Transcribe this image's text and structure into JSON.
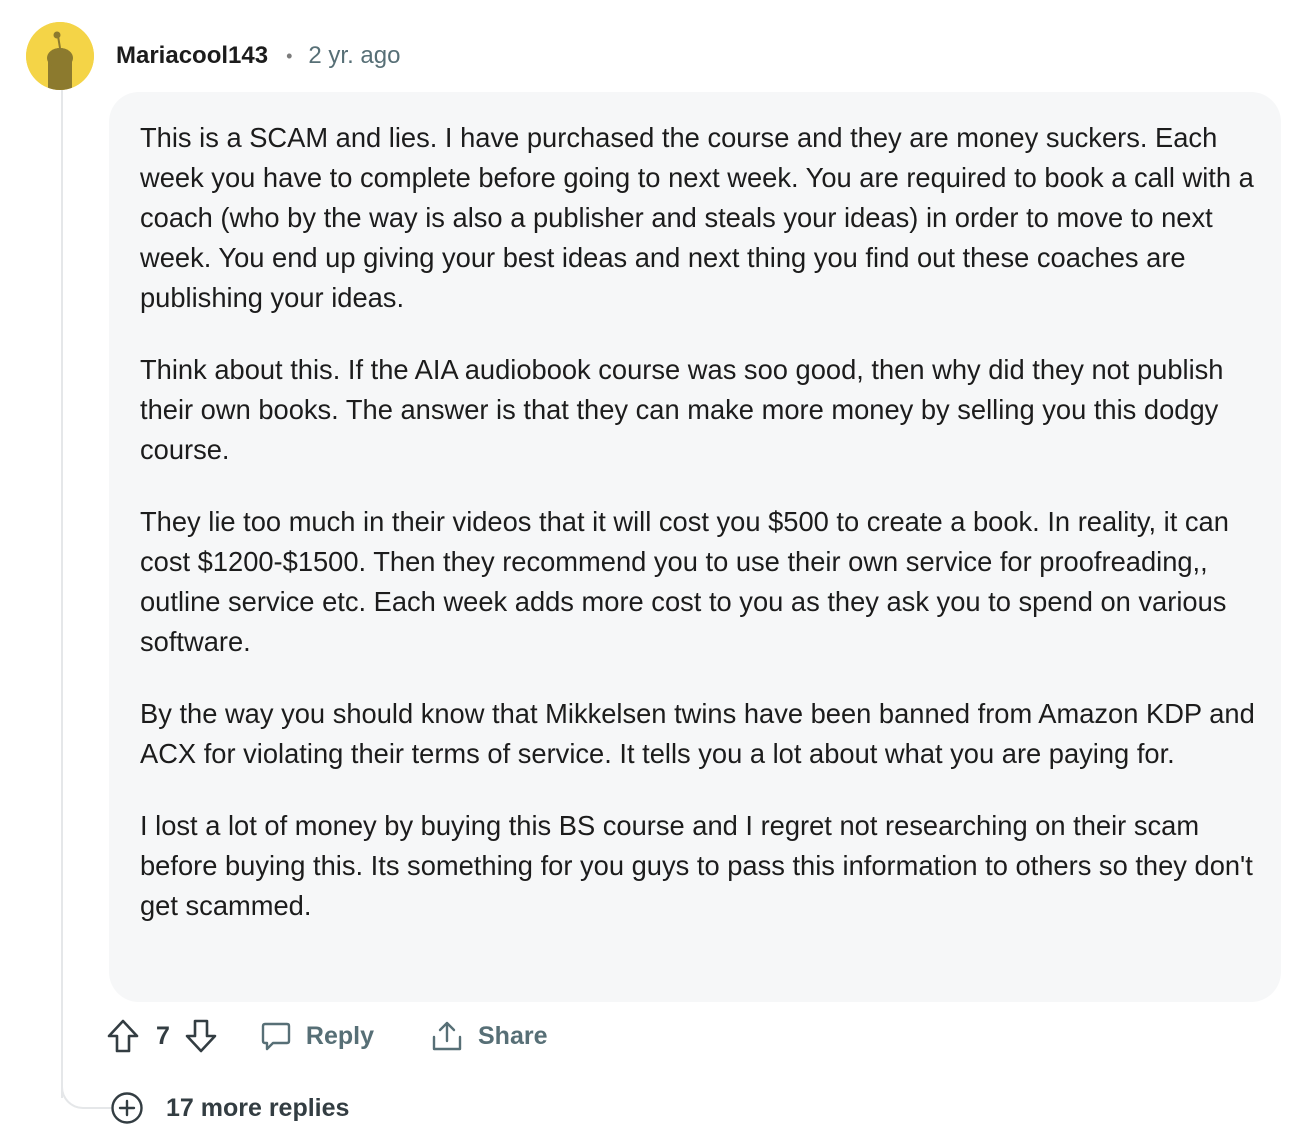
{
  "comment": {
    "author": "Mariacool143",
    "separator": "•",
    "timestamp": "2 yr. ago",
    "paragraphs": [
      "This is a SCAM and lies. I have purchased the course and they are money suckers. Each week you have to complete before going to next week. You are required to book a call with a coach (who by the way is also a publisher and steals your ideas) in order to move to next week. You end up giving your best ideas and next thing you find out these coaches are publishing your ideas.",
      "Think about this. If the AIA audiobook course was soo good, then why did they not publish their own books. The answer is that they can make more money by selling you this dodgy course.",
      "They lie too much in their videos that it will cost you $500 to create a book. In reality, it can cost $1200-$1500. Then they recommend you to use their own service for proofreading,, outline service etc. Each week adds more cost to you as they ask you to spend on various software.",
      "By the way you should know that Mikkelsen twins have been banned from Amazon KDP and ACX for violating their terms of service. It tells you a lot about what you are paying for.",
      "I lost a lot of money by buying this BS course and I regret not researching on their scam before buying this. Its something for you guys to pass this information to others so they don't get scammed."
    ],
    "vote_count": "7",
    "reply_label": "Reply",
    "share_label": "Share",
    "more_replies_label": "17 more replies"
  },
  "icons": {
    "avatar": "snoo-avatar-icon",
    "upvote": "upvote-arrow-icon",
    "downvote": "downvote-arrow-icon",
    "reply": "speech-bubble-icon",
    "share": "share-arrow-icon",
    "more": "plus-circle-icon"
  },
  "colors": {
    "avatar_bg": "#f4d447",
    "bubble_bg": "#f6f7f8",
    "thread_line": "#e5e7e9",
    "meta_text": "#576f76"
  }
}
